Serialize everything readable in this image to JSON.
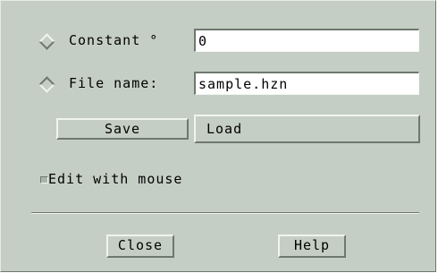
{
  "dialog": {
    "constant": {
      "label": "Constant °",
      "value": "0",
      "selected": false
    },
    "file_name": {
      "label": "File name:",
      "value": "sample.hzn",
      "selected": true
    },
    "save_label": "Save",
    "load_label": "Load",
    "edit_with_mouse": {
      "label": "Edit with mouse",
      "checked": false
    },
    "close_label": "Close",
    "help_label": "Help"
  },
  "colors": {
    "background": "#c5cec5",
    "field_background": "#ffffff"
  }
}
